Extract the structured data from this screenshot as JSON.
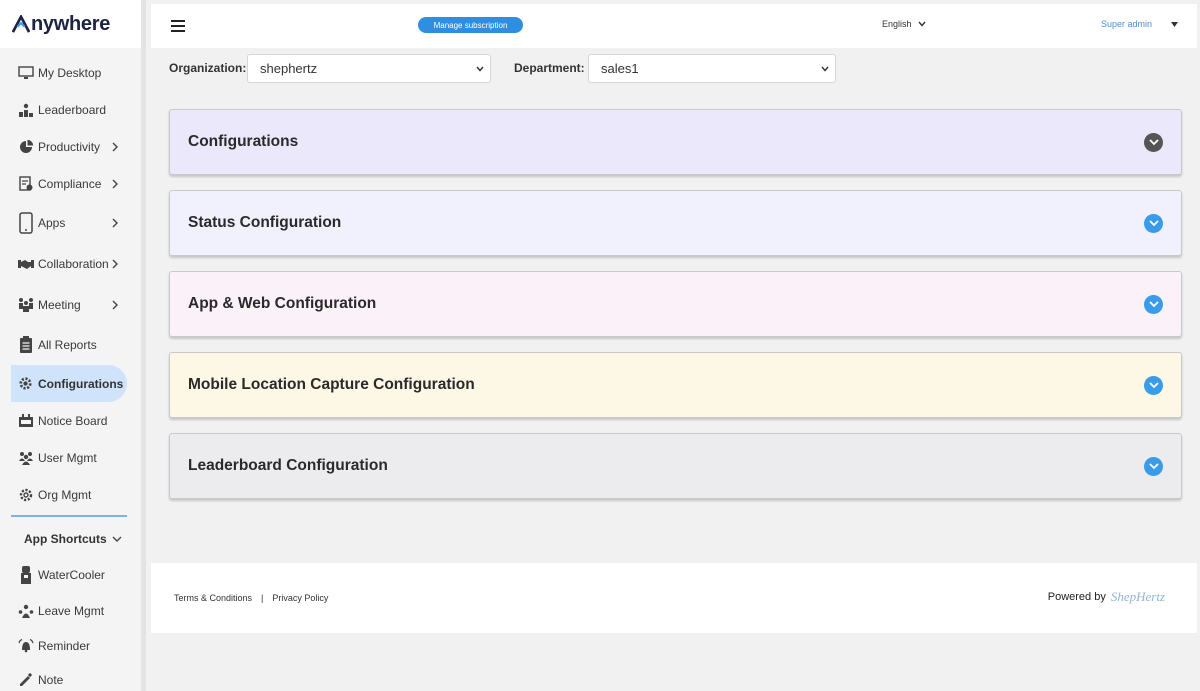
{
  "brand": {
    "logo_text": "nywhere"
  },
  "sidebar": {
    "items": [
      {
        "label": "My Desktop",
        "icon": "monitor-icon",
        "chevron": false
      },
      {
        "label": "Leaderboard",
        "icon": "podium-icon",
        "chevron": false
      },
      {
        "label": "Productivity",
        "icon": "pie-chart-icon",
        "chevron": true
      },
      {
        "label": "Compliance",
        "icon": "compliance-icon",
        "chevron": true
      },
      {
        "label": "Apps",
        "icon": "mobile-icon",
        "chevron": true
      },
      {
        "label": "Collaboration",
        "icon": "handshake-icon",
        "chevron": true
      },
      {
        "label": "Meeting",
        "icon": "meeting-icon",
        "chevron": true
      },
      {
        "label": "All Reports",
        "icon": "clipboard-icon",
        "chevron": false
      },
      {
        "label": "Configurations",
        "icon": "gear-icon",
        "chevron": false,
        "active": true
      },
      {
        "label": "Notice Board",
        "icon": "notice-board-icon",
        "chevron": false
      },
      {
        "label": "User Mgmt",
        "icon": "users-icon",
        "chevron": false
      },
      {
        "label": "Org Mgmt",
        "icon": "org-gear-icon",
        "chevron": false
      }
    ],
    "shortcuts_label": "App Shortcuts",
    "shortcuts": [
      {
        "label": "WaterCooler",
        "icon": "watercooler-icon"
      },
      {
        "label": "Leave Mgmt",
        "icon": "leave-icon"
      },
      {
        "label": "Reminder",
        "icon": "bell-icon"
      },
      {
        "label": "Note",
        "icon": "note-icon"
      }
    ]
  },
  "header": {
    "manage_subscription": "Manage subscription",
    "language": "English",
    "user": "Super admin"
  },
  "filters": {
    "organization_label": "Organization:",
    "organization_value": "shephertz",
    "department_label": "Department:",
    "department_value": "sales1"
  },
  "panels": [
    {
      "title": "Configurations",
      "bg": "#ebe8fb",
      "button_color": "#555555"
    },
    {
      "title": "Status Configuration",
      "bg": "#f1f0fd",
      "button_color": "#3a9be8"
    },
    {
      "title": "App & Web Configuration",
      "bg": "#fbf1f8",
      "button_color": "#3a9be8"
    },
    {
      "title": "Mobile Location Capture Configuration",
      "bg": "#fdf7e5",
      "button_color": "#3a9be8"
    },
    {
      "title": "Leaderboard Configuration",
      "bg": "#ececef",
      "button_color": "#3a9be8"
    }
  ],
  "footer": {
    "terms": "Terms & Conditions",
    "separator": "|",
    "privacy": "Privacy Policy",
    "powered_by": "Powered by",
    "brand": "ShepHertz"
  }
}
